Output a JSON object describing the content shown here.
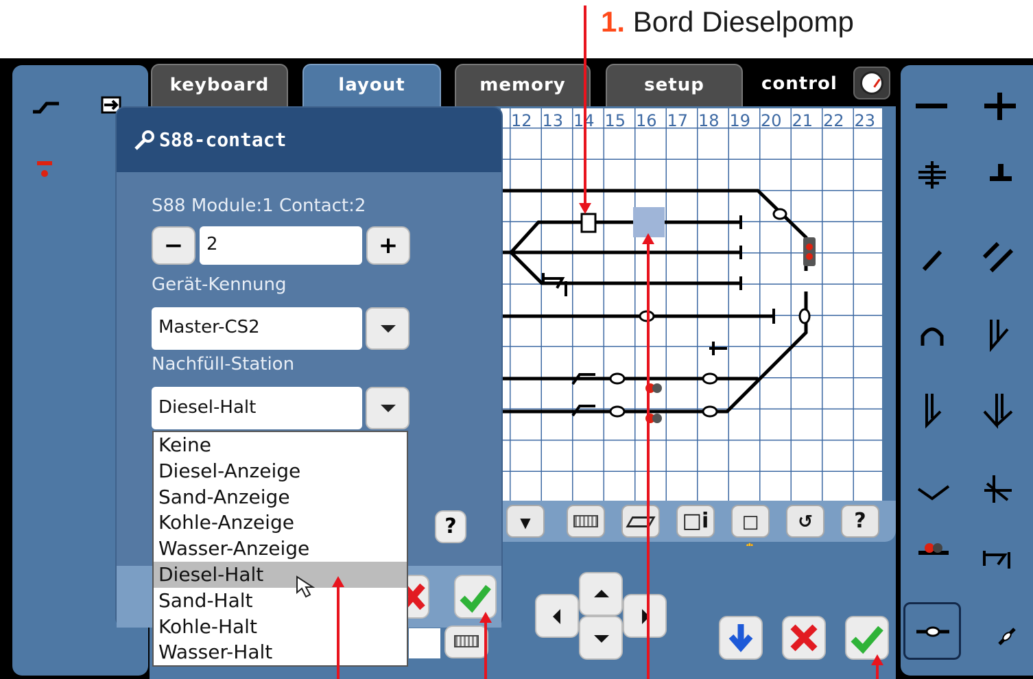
{
  "annotation": {
    "number": "1.",
    "text": "Bord Dieselpomp"
  },
  "tabs": {
    "keyboard": "keyboard",
    "layout": "layout",
    "memory": "memory",
    "setup": "setup",
    "control": "control"
  },
  "grid": {
    "columns": [
      "12",
      "13",
      "14",
      "15",
      "16",
      "17",
      "18",
      "19",
      "20",
      "21",
      "22",
      "23"
    ]
  },
  "dialog": {
    "title": "S88-contact",
    "module_info": "S88 Module:1 Contact:2",
    "contact_value": "2",
    "minus": "−",
    "plus": "+",
    "device_label": "Gerät-Kennung",
    "device_value": "Master-CS2",
    "station_label": "Nachfüll-Station",
    "station_value": "Diesel-Halt",
    "options": [
      "Keine",
      "Diesel-Anzeige",
      "Sand-Anzeige",
      "Kohle-Anzeige",
      "Wasser-Anzeige",
      "Diesel-Halt",
      "Sand-Halt",
      "Kohle-Halt",
      "Wasser-Halt"
    ],
    "selected_option": "Diesel-Halt",
    "help": "?"
  },
  "toolbar": {
    "help": "?"
  },
  "colors": {
    "panel": "#4e78a4",
    "dialog_header": "#284d7b",
    "annotation_red": "#e8141e",
    "accent_orange": "#ff4a1a",
    "grid_line": "#3d69a3"
  }
}
